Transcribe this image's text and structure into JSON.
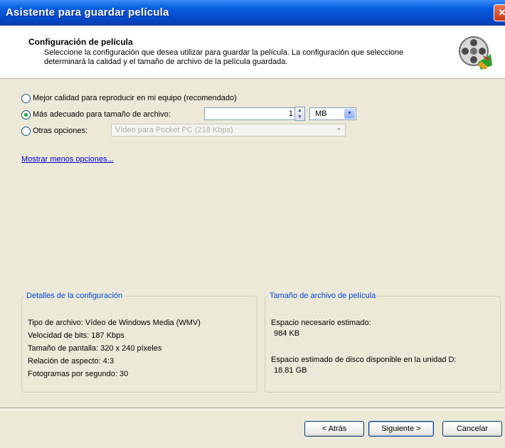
{
  "window": {
    "title": "Asistente para guardar película",
    "close_glyph": "✕"
  },
  "header": {
    "title": "Configuración de película",
    "description": "Seleccione la configuración que desea utilizar para guardar la película. La configuración que seleccione determinará la calidad y el tamaño de archivo de la película guardada.",
    "icon": "film-reel-icon"
  },
  "options": {
    "best_quality": {
      "label": "Mejor calidad para reproducir en mi equipo (recomendado)",
      "selected": false
    },
    "file_size": {
      "label": "Más adecuado para tamaño de archivo:",
      "selected": true,
      "value": "1",
      "unit": "MB"
    },
    "other": {
      "label": "Otras opciones:",
      "selected": false,
      "value": "Vídeo para Pocket PC (218 Kbps)",
      "enabled": false
    },
    "toggle_link": "Mostrar menos opciones..."
  },
  "details": {
    "legend": "Detalles de la configuración",
    "lines": [
      "Tipo de archivo: Vídeo de Windows Media (WMV)",
      "Velocidad de bits: 187 Kbps",
      "Tamaño de pantalla: 320 x 240 píxeles",
      "Relación de aspecto: 4:3",
      "Fotogramas por segundo: 30"
    ]
  },
  "size_info": {
    "legend": "Tamaño de archivo de película",
    "estimated_label": "Espacio necesario estimado:",
    "estimated_value": "984 KB",
    "disk_label": "Espacio estimado de disco disponible en la unidad D:",
    "disk_value": "18.81 GB"
  },
  "buttons": {
    "back": "< Atrás",
    "next": "Siguiente >",
    "cancel": "Cancelar"
  },
  "colors": {
    "titlebar": "#0548c8",
    "legend": "#0046d5",
    "link": "#0000cc",
    "radio_dot": "#21a121"
  }
}
